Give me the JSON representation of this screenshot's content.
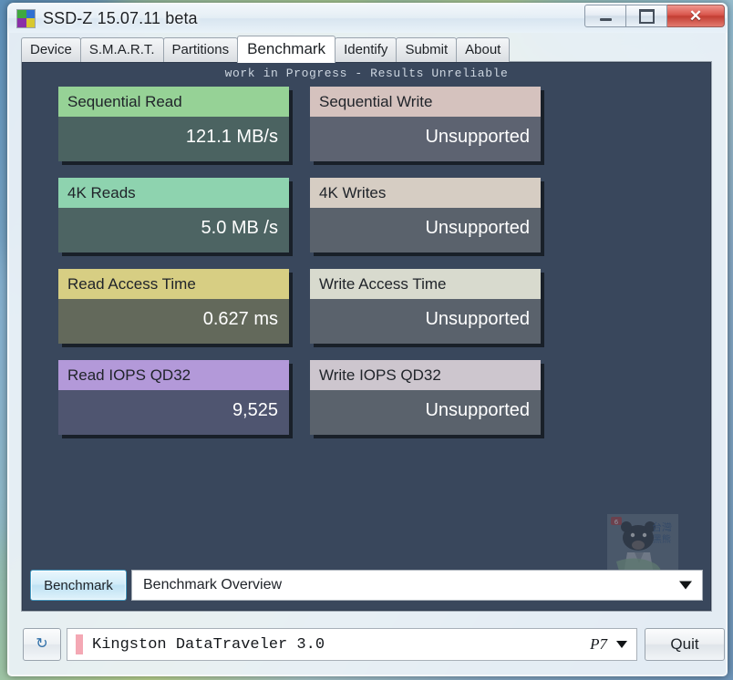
{
  "window": {
    "title": "SSD-Z 15.07.11 beta",
    "icon_name": "ssd-z-logo-icon",
    "icon_colors": [
      "#3fa83f",
      "#2f6fd0",
      "#8a2fa8",
      "#d8c82f"
    ],
    "controls": {
      "minimize": "–",
      "maximize": "❐",
      "close": "✕"
    }
  },
  "tabs": [
    {
      "label": "Device",
      "active": false
    },
    {
      "label": "S.M.A.R.T.",
      "active": false
    },
    {
      "label": "Partitions",
      "active": false
    },
    {
      "label": "Benchmark",
      "active": true
    },
    {
      "label": "Identify",
      "active": false
    },
    {
      "label": "Submit",
      "active": false
    },
    {
      "label": "About",
      "active": false
    }
  ],
  "panel": {
    "notice": "work in Progress - Results Unreliable",
    "background": "#39475c",
    "cards": [
      {
        "title": "Sequential Read",
        "value": "121.1 MB/s",
        "header_color": "#96d296",
        "body_color": "#4b6361"
      },
      {
        "title": "Sequential Write",
        "value": "Unsupported",
        "header_color": "#d5c2be",
        "body_color": "#5d6371"
      },
      {
        "title": "4K Reads",
        "value": "5.0 MB /s",
        "header_color": "#8ed3af",
        "body_color": "#4d6463"
      },
      {
        "title": "4K Writes",
        "value": "Unsupported",
        "header_color": "#d6cdc3",
        "body_color": "#5a626c"
      },
      {
        "title": "Read Access Time",
        "value": "0.627 ms",
        "header_color": "#d7ce83",
        "body_color": "#63695b"
      },
      {
        "title": "Write Access Time",
        "value": "Unsupported",
        "header_color": "#d8dace",
        "body_color": "#5a626c"
      },
      {
        "title": "Read IOPS QD32",
        "value": "9,525",
        "header_color": "#b399d9",
        "body_color": "#4f5570"
      },
      {
        "title": "Write IOPS QD32",
        "value": "Unsupported",
        "header_color": "#cdc6ce",
        "body_color": "#5a626c"
      }
    ],
    "benchmark_button": "Benchmark",
    "view_select": {
      "value": "Benchmark Overview",
      "arrow_icon": "chevron-down-icon"
    },
    "watermark_name": "taiwan-black-bear-watermark"
  },
  "statusbar": {
    "refresh_icon": "↻",
    "device_name": "Kingston DataTraveler 3.0",
    "device_swatch_color": "#f4a8b4",
    "port_label": "P7",
    "port_arrow_icon": "chevron-down-icon",
    "quit_label": "Quit"
  }
}
